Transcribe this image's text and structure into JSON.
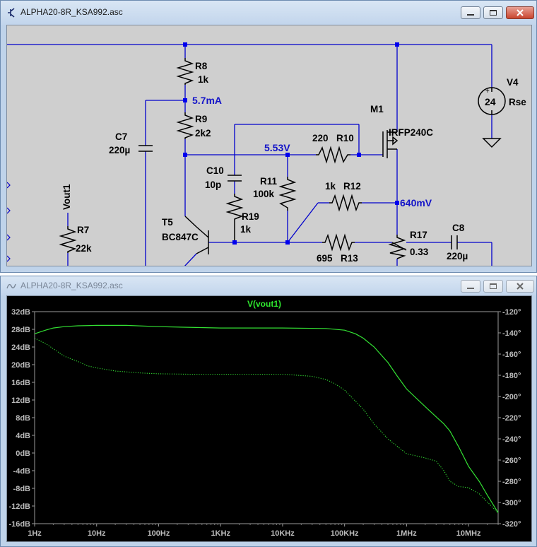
{
  "schematic_window": {
    "title": "ALPHA20-8R_KSA992.asc",
    "icon": "transistor-icon",
    "components": {
      "R8": {
        "name": "R8",
        "value": "1k"
      },
      "R9": {
        "name": "R9",
        "value": "2k2"
      },
      "C7": {
        "name": "C7",
        "value": "220µ"
      },
      "C10": {
        "name": "C10",
        "value": "10p"
      },
      "R10": {
        "name": "R10",
        "value": "220"
      },
      "M1": {
        "name": "M1",
        "value": "IRFP240C"
      },
      "V4": {
        "name": "V4",
        "value": "24",
        "extra": "Rse"
      },
      "R11": {
        "name": "R11",
        "value": "100k"
      },
      "R12": {
        "name": "R12",
        "value": "1k"
      },
      "R19": {
        "name": "R19",
        "value": "1k"
      },
      "T5": {
        "name": "T5",
        "value": "BC847C"
      },
      "R7": {
        "name": "R7",
        "value": "22k"
      },
      "R13": {
        "name": "R13",
        "value": "695"
      },
      "R17": {
        "name": "R17",
        "value": "0.33"
      },
      "C8": {
        "name": "C8",
        "value": "220µ"
      }
    },
    "net_label": "Vout1",
    "annotations": {
      "current": "5.7mA",
      "v1": "5.53V",
      "v2": "640mV"
    },
    "colors": {
      "wire": "#0000cc",
      "annotation": "#1414c8",
      "background": "#cfcfcf"
    }
  },
  "plot_window": {
    "title": "ALPHA20-8R_KSA992.asc",
    "icon": "waveform-icon",
    "chart_data": {
      "type": "line",
      "title": "V(vout1)",
      "x_scale": "log",
      "x_ticks": [
        "1Hz",
        "10Hz",
        "100Hz",
        "1KHz",
        "10KHz",
        "100KHz",
        "1MHz",
        "10MHz"
      ],
      "xlim": [
        1,
        30000000
      ],
      "y_left_ticks": [
        "32dB",
        "28dB",
        "24dB",
        "20dB",
        "16dB",
        "12dB",
        "8dB",
        "4dB",
        "0dB",
        "-4dB",
        "-8dB",
        "-12dB",
        "-16dB"
      ],
      "ylim_left": [
        -16,
        32
      ],
      "y_right_ticks": [
        "-120°",
        "-140°",
        "-160°",
        "-180°",
        "-200°",
        "-220°",
        "-240°",
        "-260°",
        "-280°",
        "-300°",
        "-320°"
      ],
      "ylim_right": [
        -320,
        -120
      ],
      "series": [
        {
          "style": "solid",
          "axis": "left",
          "x": [
            1,
            1.5,
            2,
            3,
            5,
            10,
            30,
            100,
            1000,
            10000,
            50000,
            100000,
            150000,
            200000,
            300000,
            500000,
            700000,
            1000000,
            2000000,
            3000000,
            4000000,
            5000000,
            7000000,
            10000000,
            15000000,
            20000000,
            30000000
          ],
          "values": [
            27,
            27.8,
            28.3,
            28.6,
            28.8,
            28.9,
            28.9,
            28.6,
            28.3,
            28.3,
            28.2,
            27.8,
            27,
            26,
            24,
            20.5,
            17.5,
            14.5,
            10.5,
            8.2,
            6.6,
            5,
            1.3,
            -3,
            -6.5,
            -9.5,
            -13.5
          ]
        },
        {
          "style": "dotted",
          "axis": "right",
          "x": [
            1,
            1.5,
            2,
            3,
            5,
            7,
            10,
            20,
            50,
            100,
            300,
            1000,
            10000,
            30000,
            50000,
            70000,
            100000,
            200000,
            300000,
            500000,
            1000000,
            2000000,
            3000000,
            4000000,
            5000000,
            7000000,
            10000000,
            15000000,
            30000000
          ],
          "values": [
            -145,
            -150,
            -155,
            -162,
            -167,
            -171,
            -173,
            -176,
            -177.8,
            -178.6,
            -179,
            -179,
            -179,
            -181,
            -184,
            -188,
            -194,
            -212,
            -226,
            -240,
            -254,
            -258,
            -261,
            -270,
            -280,
            -285,
            -286,
            -292,
            -310
          ]
        }
      ]
    }
  }
}
